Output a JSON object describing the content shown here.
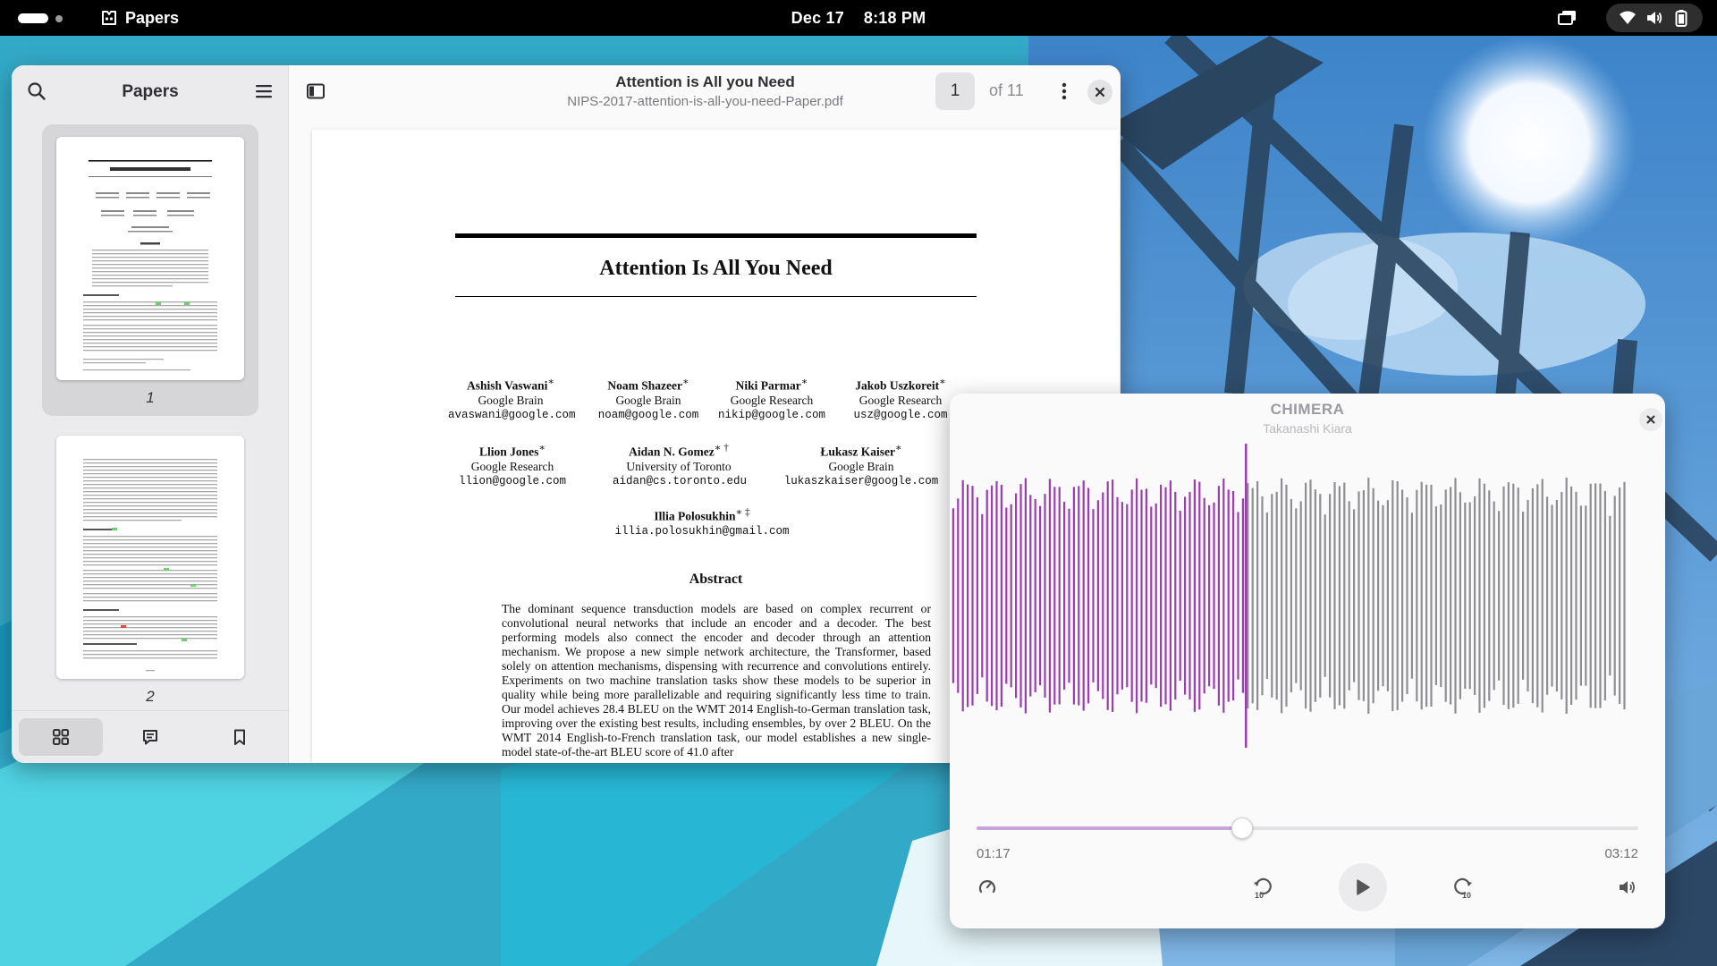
{
  "topbar": {
    "app_name": "Papers",
    "date": "Dec 17",
    "time": "8:18 PM",
    "icons": [
      "activities-indicator",
      "papers-app-icon",
      "screen-share-icon",
      "wifi-icon",
      "volume-icon",
      "battery-icon"
    ]
  },
  "papers": {
    "sidebar_title": "Papers",
    "thumbnails": [
      {
        "label": "1",
        "selected": true
      },
      {
        "label": "2",
        "selected": false
      }
    ],
    "footer_tabs": [
      "thumbnails-view",
      "annotations-view",
      "bookmarks-view"
    ],
    "doc_title": "Attention is All you Need",
    "doc_filename": "NIPS-2017-attention-is-all-you-need-Paper.pdf",
    "current_page": "1",
    "page_total": "of 11",
    "page": {
      "title": "Attention Is All You Need",
      "authors": [
        {
          "name": "Ashish Vaswani",
          "mark": "∗",
          "affil": "Google Brain",
          "email": "avaswani@google.com"
        },
        {
          "name": "Noam Shazeer",
          "mark": "∗",
          "affil": "Google Brain",
          "email": "noam@google.com"
        },
        {
          "name": "Niki Parmar",
          "mark": "∗",
          "affil": "Google Research",
          "email": "nikip@google.com"
        },
        {
          "name": "Jakob Uszkoreit",
          "mark": "∗",
          "affil": "Google Research",
          "email": "usz@google.com"
        },
        {
          "name": "Llion Jones",
          "mark": "∗",
          "affil": "Google Research",
          "email": "llion@google.com"
        },
        {
          "name": "Aidan N. Gomez",
          "mark": "∗ †",
          "affil": "University of Toronto",
          "email": "aidan@cs.toronto.edu"
        },
        {
          "name": "Łukasz Kaiser",
          "mark": "∗",
          "affil": "Google Brain",
          "email": "lukaszkaiser@google.com"
        },
        {
          "name": "Illia Polosukhin",
          "mark": "∗ ‡",
          "affil": "",
          "email": "illia.polosukhin@gmail.com"
        }
      ],
      "abstract_heading": "Abstract",
      "abstract_text": "The dominant sequence transduction models are based on complex recurrent or convolutional neural networks that include an encoder and a decoder. The best performing models also connect the encoder and decoder through an attention mechanism. We propose a new simple network architecture, the Transformer, based solely on attention mechanisms, dispensing with recurrence and convolutions entirely. Experiments on two machine translation tasks show these models to be superior in quality while being more parallelizable and requiring significantly less time to train. Our model achieves 28.4 BLEU on the WMT 2014 English-to-German translation task, improving over the existing best results, including ensembles, by over 2 BLEU. On the WMT 2014 English-to-French translation task, our model establishes a new single-model state-of-the-art BLEU score of 41.0 after"
    },
    "zoom_buttons": [
      "zoom-in",
      "zoom-out"
    ]
  },
  "player": {
    "track_title": "CHIMERA",
    "artist": "Takanashi Kiara",
    "current_time": "01:17",
    "total_time": "03:12",
    "progress_fraction": 0.401,
    "accent_color": "#9b3fb0",
    "controls": [
      "playback-speed",
      "rewind-10",
      "play",
      "forward-10",
      "volume"
    ]
  }
}
